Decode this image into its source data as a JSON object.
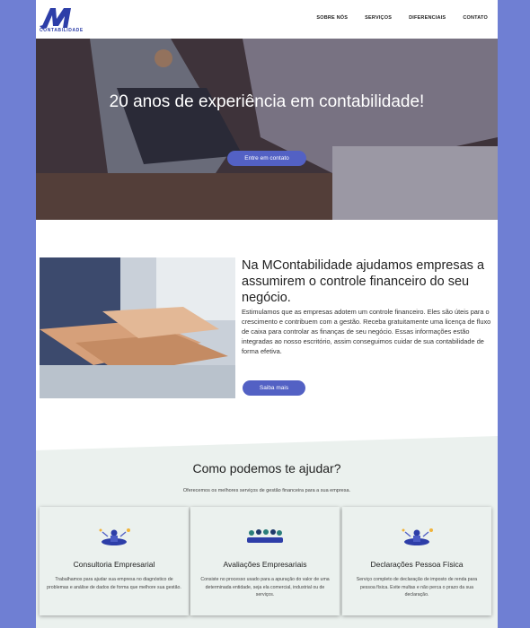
{
  "header": {
    "logo_text": "CONTABILIDADE",
    "nav": [
      "SOBRE NÓS",
      "SERVIÇOS",
      "DIFERENCIAIS",
      "CONTATO"
    ]
  },
  "hero": {
    "title": "20 anos de experiência em contabilidade!",
    "cta": "Entre em contato"
  },
  "about": {
    "title": "Na MContabilidade ajudamos empresas a assumirem o controle financeiro do seu negócio.",
    "text": "Estimulamos que as empresas adotem um controle financeiro. Eles são úteis para o crescimento e contribuem com a gestão. Receba gratuitamente uma licença de fluxo de caixa para controlar as finanças de seu negócio. Essas informações estão integradas ao nosso escritório, assim conseguimos cuidar de sua contabilidade de forma efetiva.",
    "button": "Saiba mais"
  },
  "services": {
    "title": "Como podemos te ajudar?",
    "subtitle": "Oferecemos os melhores serviços de gestão financeira para a sua empresa.",
    "cards": [
      {
        "title": "Consultoria Empresarial",
        "text": "Trabalhamos para ajudar sua empresa no diagnóstico de problemas e análise de dados de forma que melhore sua gestão.",
        "icon": "meditating-person-icon"
      },
      {
        "title": "Avaliações Empresariais",
        "text": "Consiste no processo usado para a apuração do valor de uma determinada entidade, seja ela comercial, industrial ou de serviços.",
        "icon": "team-meeting-icon"
      },
      {
        "title": "Declarações Pessoa Física",
        "text": "Serviço completo de declaração de imposto de renda para pessoa física. Evite multas e não perca o prazo da sua declaração.",
        "icon": "meditating-person-icon"
      }
    ]
  },
  "colors": {
    "accent": "#5361c4",
    "page_bg": "#6f7fd3",
    "logo": "#2d3ea8",
    "section_bg": "#ebf1ee"
  }
}
